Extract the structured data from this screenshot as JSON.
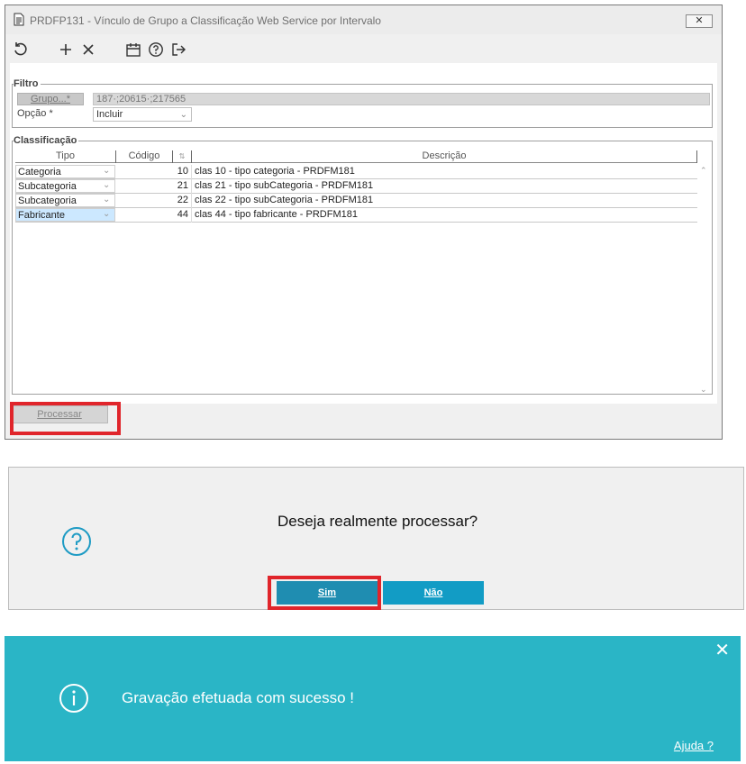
{
  "window": {
    "title": "PRDFP131 - Vínculo de Grupo a Classificação Web Service por Intervalo",
    "close_label": "✕"
  },
  "toolbar": {
    "icons": [
      "refresh-icon",
      "add-icon",
      "delete-icon",
      "calendar-icon",
      "help-icon",
      "exit-icon"
    ]
  },
  "filtro": {
    "legend": "Filtro",
    "grupo_label": "Grupo...*",
    "grupo_value": "187·;20615·;217565",
    "opcao_label": "Opção *",
    "opcao_value": "Incluir"
  },
  "classificacao": {
    "legend": "Classificação",
    "columns": {
      "tipo": "Tipo",
      "codigo": "Código",
      "descricao": "Descrição"
    },
    "rows": [
      {
        "tipo": "Categoria",
        "codigo": "10",
        "descricao": "clas 10 - tipo categoria - PRDFM181"
      },
      {
        "tipo": "Subcategoria",
        "codigo": "21",
        "descricao": "clas 21 - tipo subCategoria - PRDFM181"
      },
      {
        "tipo": "Subcategoria",
        "codigo": "22",
        "descricao": "clas 22 - tipo subCategoria - PRDFM181"
      },
      {
        "tipo": "Fabricante",
        "codigo": "44",
        "descricao": "clas 44 - tipo fabricante - PRDFM181"
      }
    ]
  },
  "actions": {
    "processar_label": "Processar"
  },
  "confirm": {
    "message": "Deseja realmente processar?",
    "sim_label": "Sim",
    "nao_label": "Não"
  },
  "toast": {
    "message": "Gravação efetuada com sucesso !",
    "help_label": "Ajuda ?",
    "close_label": "✕"
  },
  "colors": {
    "highlight": "#e0252b",
    "toast_bg": "#2ab5c6",
    "button_primary": "#1f8db1",
    "button_secondary": "#129cc5"
  }
}
